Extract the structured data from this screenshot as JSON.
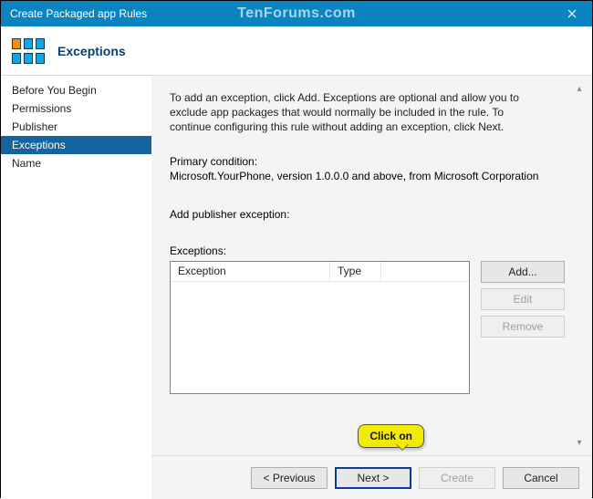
{
  "window": {
    "title": "Create Packaged app Rules",
    "watermark": "TenForums.com"
  },
  "header": {
    "title": "Exceptions"
  },
  "sidebar": {
    "items": [
      {
        "label": "Before You Begin",
        "selected": false
      },
      {
        "label": "Permissions",
        "selected": false
      },
      {
        "label": "Publisher",
        "selected": false
      },
      {
        "label": "Exceptions",
        "selected": true
      },
      {
        "label": "Name",
        "selected": false
      }
    ]
  },
  "content": {
    "description": "To add an exception, click Add. Exceptions are optional and allow you to exclude app packages that would normally be included in the rule. To continue configuring this rule without adding an exception, click Next.",
    "primary_condition_label": "Primary condition:",
    "primary_condition": "Microsoft.YourPhone, version 1.0.0.0 and above, from Microsoft Corporation",
    "add_publisher_label": "Add publisher exception:",
    "exceptions_label": "Exceptions:",
    "columns": {
      "exception": "Exception",
      "type": "Type"
    },
    "buttons": {
      "add": "Add...",
      "edit": "Edit",
      "remove": "Remove"
    }
  },
  "footer": {
    "previous": "< Previous",
    "next": "Next >",
    "create": "Create",
    "cancel": "Cancel"
  },
  "tooltip": {
    "text": "Click on"
  }
}
